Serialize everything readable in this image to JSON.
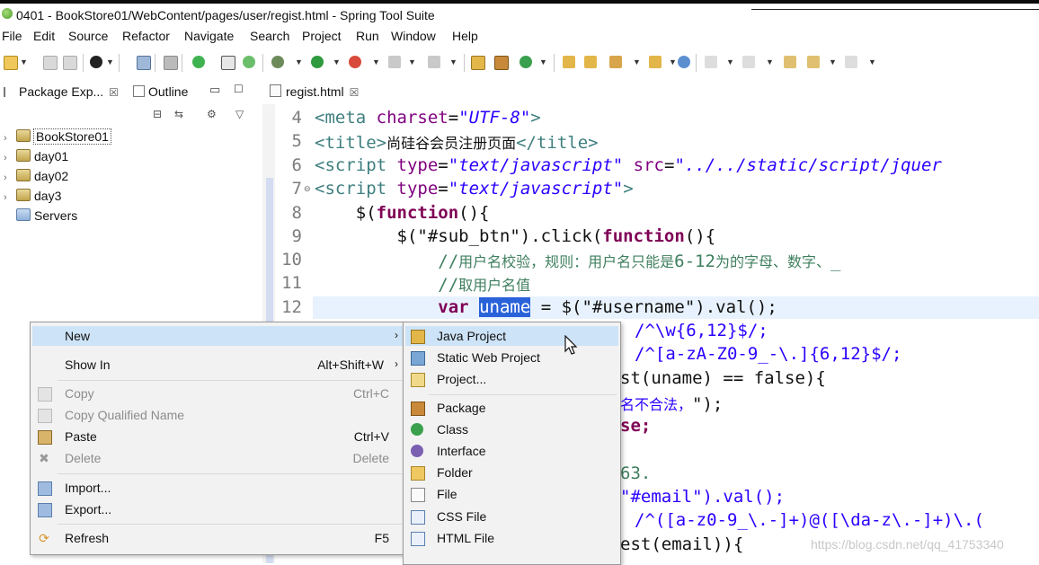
{
  "window": {
    "title": "0401 - BookStore01/WebContent/pages/user/regist.html - Spring Tool Suite"
  },
  "menubar": [
    "File",
    "Edit",
    "Source",
    "Refactor",
    "Navigate",
    "Search",
    "Project",
    "Run",
    "Window",
    "Help"
  ],
  "package_explorer": {
    "tab_label": "Package Exp...",
    "outline_tab_label": "Outline",
    "items": [
      {
        "label": "BookStore01",
        "icon": "project-icon"
      },
      {
        "label": "day01",
        "icon": "project-icon"
      },
      {
        "label": "day02",
        "icon": "project-icon"
      },
      {
        "label": "day3",
        "icon": "project-icon"
      },
      {
        "label": "Servers",
        "icon": "servers-folder-icon"
      }
    ]
  },
  "editor": {
    "tab_label": "regist.html",
    "line_numbers": [
      "4",
      "5",
      "6",
      "7",
      "8",
      "9",
      "10",
      "11",
      "12"
    ],
    "partial_code": {
      "l13": "/^\\w{6,12}$/;",
      "l14": "/^[a-zA-Z0-9_-\\.]{6,12}$/;",
      "l15": "st(uname) == false){",
      "l16a": "名不合法，",
      "l16b": "\");",
      "l17": "se;",
      "l19": "63.",
      "l20": "\"#email\").val();",
      "l21": "/^([a-z0-9_\\.-]+)@([\\da-z\\.-]+)\\.(",
      "l22": "est(email)){"
    }
  },
  "context_menu": {
    "items": [
      {
        "label": "New",
        "shortcut": "",
        "submenu": true,
        "enabled": true,
        "active": true
      },
      {
        "label": "Show In",
        "shortcut": "Alt+Shift+W",
        "submenu": true,
        "enabled": true
      },
      {
        "label": "Copy",
        "shortcut": "Ctrl+C",
        "enabled": false
      },
      {
        "label": "Copy Qualified Name",
        "shortcut": "",
        "enabled": false
      },
      {
        "label": "Paste",
        "shortcut": "Ctrl+V",
        "enabled": true
      },
      {
        "label": "Delete",
        "shortcut": "Delete",
        "enabled": false
      },
      {
        "label": "Import...",
        "shortcut": "",
        "enabled": true
      },
      {
        "label": "Export...",
        "shortcut": "",
        "enabled": true
      },
      {
        "label": "Refresh",
        "shortcut": "F5",
        "enabled": true
      }
    ]
  },
  "new_submenu": {
    "items": [
      {
        "label": "Java Project",
        "icon": "java-project-icon",
        "active": true
      },
      {
        "label": "Static Web Project",
        "icon": "web-project-icon"
      },
      {
        "label": "Project...",
        "icon": "new-project-icon"
      },
      {
        "label": "Package",
        "icon": "package-icon"
      },
      {
        "label": "Class",
        "icon": "class-icon"
      },
      {
        "label": "Interface",
        "icon": "interface-icon"
      },
      {
        "label": "Folder",
        "icon": "folder-icon"
      },
      {
        "label": "File",
        "icon": "file-icon"
      },
      {
        "label": "CSS File",
        "icon": "css-file-icon"
      },
      {
        "label": "HTML File",
        "icon": "html-file-icon"
      }
    ]
  },
  "watermark": "https://blog.csdn.net/qq_41753340",
  "colors": {
    "menu_bg": "#f2f2f2",
    "menu_highlight": "#cde3f7",
    "code_tag": "#3f7f7f",
    "code_attr": "#7f007f",
    "code_string": "#2a00ff",
    "code_keyword": "#7f0055",
    "code_comment": "#3f7f5f",
    "selection": "#2a62d9"
  }
}
